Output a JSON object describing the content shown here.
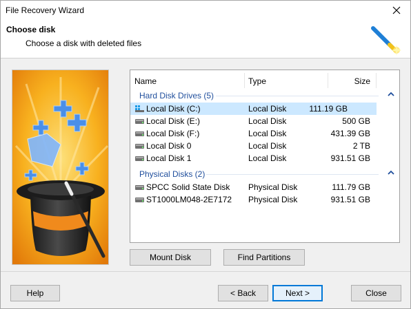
{
  "window": {
    "title": "File Recovery Wizard"
  },
  "header": {
    "title": "Choose disk",
    "subtitle": "Choose a disk with deleted files"
  },
  "list": {
    "columns": {
      "name": "Name",
      "type": "Type",
      "size": "Size"
    },
    "groups": [
      {
        "label": "Hard Disk Drives (5)",
        "rows": [
          {
            "name": "Local Disk (C:)",
            "type": "Local Disk",
            "size": "111.19 GB",
            "icon": "windows-drive-icon",
            "selected": true
          },
          {
            "name": "Local Disk (E:)",
            "type": "Local Disk",
            "size": "500 GB",
            "icon": "hard-drive-icon"
          },
          {
            "name": "Local Disk (F:)",
            "type": "Local Disk",
            "size": "431.39 GB",
            "icon": "hard-drive-icon"
          },
          {
            "name": "Local Disk 0",
            "type": "Local Disk",
            "size": "2 TB",
            "icon": "hard-drive-icon"
          },
          {
            "name": "Local Disk 1",
            "type": "Local Disk",
            "size": "931.51 GB",
            "icon": "hard-drive-icon"
          }
        ]
      },
      {
        "label": "Physical Disks (2)",
        "rows": [
          {
            "name": "SPCC Solid State Disk",
            "type": "Physical Disk",
            "size": "111.79 GB",
            "icon": "hard-drive-icon"
          },
          {
            "name": "ST1000LM048-2E7172",
            "type": "Physical Disk",
            "size": "931.51 GB",
            "icon": "hard-drive-icon"
          }
        ]
      }
    ]
  },
  "buttons": {
    "mount": "Mount Disk",
    "find_partitions": "Find Partitions",
    "help": "Help",
    "back": "< Back",
    "next": "Next >",
    "close": "Close"
  },
  "colors": {
    "accent": "#0078d7",
    "selection": "#cce8ff",
    "group_text": "#1f4e9c"
  }
}
